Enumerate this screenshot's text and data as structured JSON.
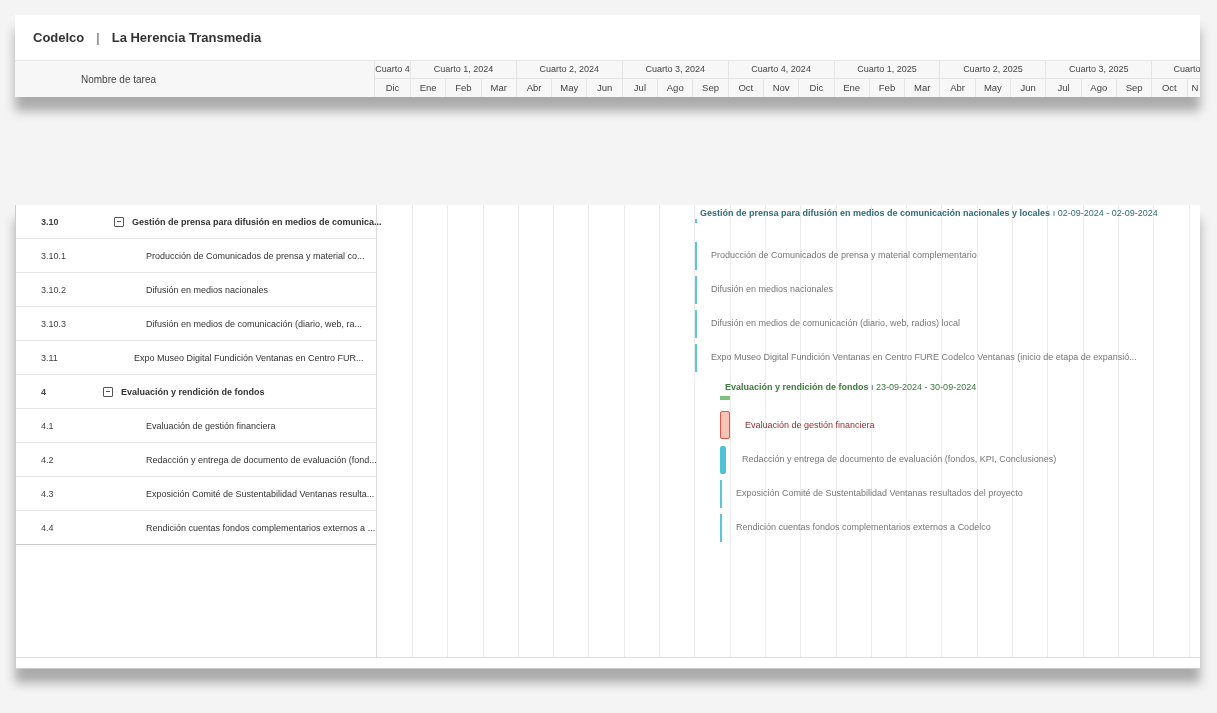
{
  "header": {
    "company": "Codelco",
    "separator": "|",
    "project": "La Herencia Transmedia"
  },
  "columns": {
    "task_name": "Nombre de tarea"
  },
  "quarters": [
    {
      "label": "Cuarto 4",
      "months": [
        "Dic"
      ]
    },
    {
      "label": "Cuarto 1, 2024",
      "months": [
        "Ene",
        "Feb",
        "Mar"
      ]
    },
    {
      "label": "Cuarto 2, 2024",
      "months": [
        "Abr",
        "May",
        "Jun"
      ]
    },
    {
      "label": "Cuarto 3, 2024",
      "months": [
        "Jul",
        "Ago",
        "Sep"
      ]
    },
    {
      "label": "Cuarto 4, 2024",
      "months": [
        "Oct",
        "Nov",
        "Dic"
      ]
    },
    {
      "label": "Cuarto 1, 2025",
      "months": [
        "Ene",
        "Feb",
        "Mar"
      ]
    },
    {
      "label": "Cuarto 2, 2025",
      "months": [
        "Abr",
        "May",
        "Jun"
      ]
    },
    {
      "label": "Cuarto 3, 2025",
      "months": [
        "Jul",
        "Ago",
        "Sep"
      ]
    },
    {
      "label": "Cuarto",
      "months": [
        "Oct",
        "N"
      ]
    }
  ],
  "tasks": [
    {
      "id": "3.10",
      "name": "Gestión de prensa para difusión en medios de comunica...",
      "expanded": true,
      "bar": {
        "kind": "summary",
        "label": "Gestión de prensa para difusión en medios de comunicación nacionales y locales",
        "separator": "ı",
        "dates": "02-09-2024 - 02-09-2024",
        "color": "#2e6b78"
      },
      "children": [
        {
          "id": "3.10.1",
          "name": "Producción de Comunicados de prensa y material co...",
          "bar": {
            "kind": "line",
            "label": "Producción de Comunicados de prensa y material complementario",
            "color": "#5bc8d8"
          }
        },
        {
          "id": "3.10.2",
          "name": "Difusión en medios nacionales",
          "bar": {
            "kind": "line",
            "label": "Difusión en medios nacionales",
            "color": "#5bc8d8"
          }
        },
        {
          "id": "3.10.3",
          "name": "Difusión en medios de comunicación (diario, web, ra...",
          "bar": {
            "kind": "line",
            "label": "Difusión en medios de comunicación (diario, web, radios) local",
            "color": "#5bc8d8"
          }
        }
      ]
    },
    {
      "id": "3.11",
      "name": "Expo Museo Digital Fundición Ventanas en Centro FUR...",
      "bar": {
        "kind": "line",
        "label": "Expo Museo Digital Fundición Ventanas en Centro FURE Codelco Ventanas (inicio de etapa de expansió...",
        "color": "#5bc8d8"
      }
    },
    {
      "id": "4",
      "name": "Evaluación y rendición de fondos",
      "expanded": true,
      "bar": {
        "kind": "summary",
        "label": "Evaluación y rendición de fondos",
        "separator": "ı",
        "dates": "23-09-2024 - 30-09-2024",
        "color": "#3d7a3d"
      },
      "children": [
        {
          "id": "4.1",
          "name": "Evaluación de gestión financiera",
          "bar": {
            "kind": "box",
            "label": "Evaluación de gestión financiera",
            "color": "#e0554a"
          }
        },
        {
          "id": "4.2",
          "name": "Redacción y entrega de documento de evaluación (fond...",
          "bar": {
            "kind": "bar",
            "label": "Redacción y entrega de documento de evaluación (fondos, KPI, Conclusiones)",
            "color": "#4fc3d4"
          }
        },
        {
          "id": "4.3",
          "name": "Exposición Comité de Sustentabilidad Ventanas resulta...",
          "bar": {
            "kind": "line",
            "label": "Exposición Comité de Sustentabilidad Ventanas resultados del proyecto",
            "color": "#5bc8d8"
          }
        },
        {
          "id": "4.4",
          "name": "Rendición cuentas fondos complementarios externos a ...",
          "bar": {
            "kind": "line",
            "label": "Rendición cuentas fondos complementarios externos a Codelco",
            "color": "#5bc8d8"
          }
        }
      ]
    }
  ]
}
